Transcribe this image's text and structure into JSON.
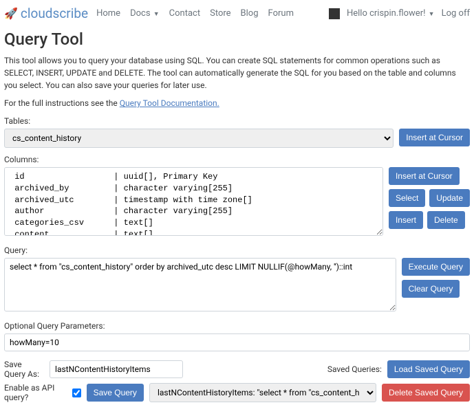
{
  "brand": "cloudscribe",
  "nav": {
    "home": "Home",
    "docs": "Docs",
    "contact": "Contact",
    "store": "Store",
    "blog": "Blog",
    "forum": "Forum",
    "greeting": "Hello crispin.flower!",
    "logoff": "Log off"
  },
  "title": "Query Tool",
  "description": "This tool allows you to query your database using SQL. You can create SQL statements for common operations such as SELECT, INSERT, UPDATE and DELETE. The tool can automatically generate the SQL for you based on the table and columns you select. You can also save your queries for later use.",
  "instructions_prefix": "For the full instructions see the ",
  "instructions_link": "Query Tool Documentation.",
  "labels": {
    "tables": "Tables:",
    "columns": "Columns:",
    "query": "Query:",
    "optional_params": "Optional Query Parameters:",
    "save_as": "Save Query As:",
    "saved_queries": "Saved Queries:",
    "enable_api": "Enable as API query?"
  },
  "buttons": {
    "insert_cursor": "Insert at Cursor",
    "select": "Select",
    "update": "Update",
    "insert": "Insert",
    "delete": "Delete",
    "execute": "Execute Query",
    "clear": "Clear Query",
    "save_query": "Save Query",
    "load_saved": "Load Saved Query",
    "delete_saved": "Delete Saved Query"
  },
  "tables_value": "cs_content_history",
  "columns_text": " id                  | uuid[], Primary Key\n archived_by         | character varying[255]\n archived_utc        | timestamp with time zone[]\n author              | character varying[255]\n categories_csv      | text[]\n content             | text[]",
  "query_value": "select * from \"cs_content_history\" order by archived_utc desc LIMIT NULLIF(@howMany, '')::int",
  "params_value": "howMany=10",
  "save_as_value": "lastNContentHistoryItems",
  "enable_api_checked": true,
  "saved_select_value": "lastNContentHistoryItems:  \"select * from \"cs_content_history\" orde...\"  (API ✅)"
}
